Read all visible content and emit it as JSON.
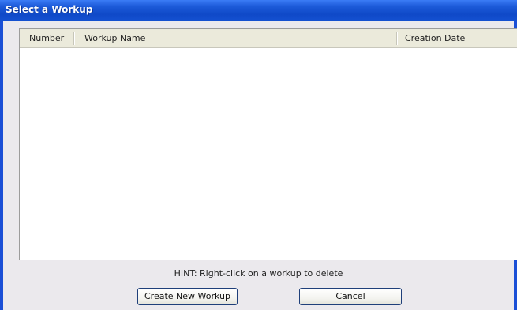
{
  "window": {
    "title": "Select a Workup"
  },
  "table": {
    "columns": [
      "Number",
      "Workup Name",
      "Creation Date"
    ],
    "rows": []
  },
  "hint": "HINT: Right-click on a workup to delete",
  "buttons": {
    "create_label": "Create New Workup",
    "cancel_label": "Cancel"
  },
  "colors": {
    "titlebar": "#1d5bd9",
    "dialog_bg": "#ebe9ed",
    "header_bg": "#ebeadb"
  }
}
